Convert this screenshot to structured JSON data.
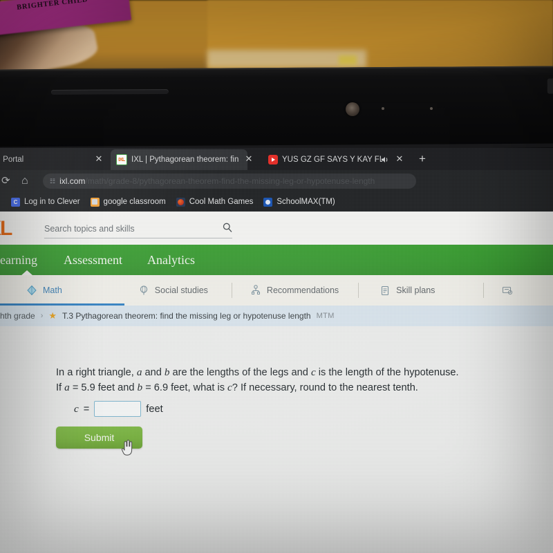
{
  "environment": {
    "book_text": "BRIGHTER CHILD"
  },
  "browser": {
    "tabs": [
      {
        "title": "| Portal",
        "favicon": "none",
        "active": false,
        "close_label": "✕",
        "has_audio": false
      },
      {
        "title": "IXL | Pythagorean theorem: fin",
        "favicon": "ixl-favicon",
        "active": true,
        "close_label": "✕",
        "has_audio": false
      },
      {
        "title": "YUS GZ GF SAYS Y KAY FL",
        "favicon": "youtube-favicon",
        "active": false,
        "close_label": "✕",
        "has_audio": true,
        "audio_glyph": "🔊"
      }
    ],
    "new_tab_label": "+",
    "toolbar": {
      "reload_glyph": "⟳",
      "home_glyph": "⌂",
      "site_info_glyph": "☷"
    },
    "omnibox": {
      "host": "ixl.com",
      "path": "/math/grade-8/pythagorean-theorem-find-the-missing-leg-or-hypotenuse-length"
    },
    "bookmarks": [
      {
        "label": "Log in to Clever",
        "icon": "clever-icon",
        "letter": "C"
      },
      {
        "label": "google classroom",
        "icon": "google-classroom-icon",
        "letter": ""
      },
      {
        "label": "Cool Math Games",
        "icon": "cool-math-games-icon",
        "letter": ""
      },
      {
        "label": "SchoolMAX(TM)",
        "icon": "schoolmax-icon",
        "letter": ""
      }
    ]
  },
  "ixl": {
    "logo": "XL",
    "search": {
      "placeholder": "Search topics and skills",
      "icon": "search-icon"
    },
    "green_nav": [
      {
        "label": "earning",
        "active": true
      },
      {
        "label": "Assessment",
        "active": false
      },
      {
        "label": "Analytics",
        "active": false
      }
    ],
    "subnav": [
      {
        "label": "Math",
        "icon": "math-icon",
        "active": true
      },
      {
        "label": "Social studies",
        "icon": "social-studies-icon",
        "active": false
      },
      {
        "label": "Recommendations",
        "icon": "recommendations-icon",
        "active": false
      },
      {
        "label": "Skill plans",
        "icon": "skill-plans-icon",
        "active": false
      }
    ],
    "breadcrumb": {
      "grade": "hth grade",
      "separator": "›",
      "star_icon": "star-icon",
      "skill_title": "T.3 Pythagorean theorem: find the missing leg or hypotenuse length",
      "code": "MTM"
    },
    "question": {
      "line1_a": "In a right triangle, ",
      "line1_var_a": "a",
      "line1_b": " and ",
      "line1_var_b": "b",
      "line1_c": " are the lengths of the legs and ",
      "line1_var_c": "c",
      "line1_d": " is the length of the hypotenuse.",
      "line2_a": "If ",
      "line2_var_a": "a",
      "line2_b": " = 5.9 feet and ",
      "line2_var_b": "b",
      "line2_c": " = 6.9 feet, what is ",
      "line2_var_c": "c",
      "line2_d": "? If necessary, round to the nearest tenth."
    },
    "answer": {
      "label_var": "c",
      "equals": "=",
      "value": "",
      "placeholder": "",
      "unit": "feet"
    },
    "submit_label": "Submit"
  },
  "colors": {
    "ixl_orange": "#e8650d",
    "ixl_green": "#3da035",
    "submit_green": "#7fb848",
    "active_tab_blue": "#2f7fc2",
    "breadcrumb_bg": "#d7e3ec",
    "star_gold": "#e9a21c"
  }
}
